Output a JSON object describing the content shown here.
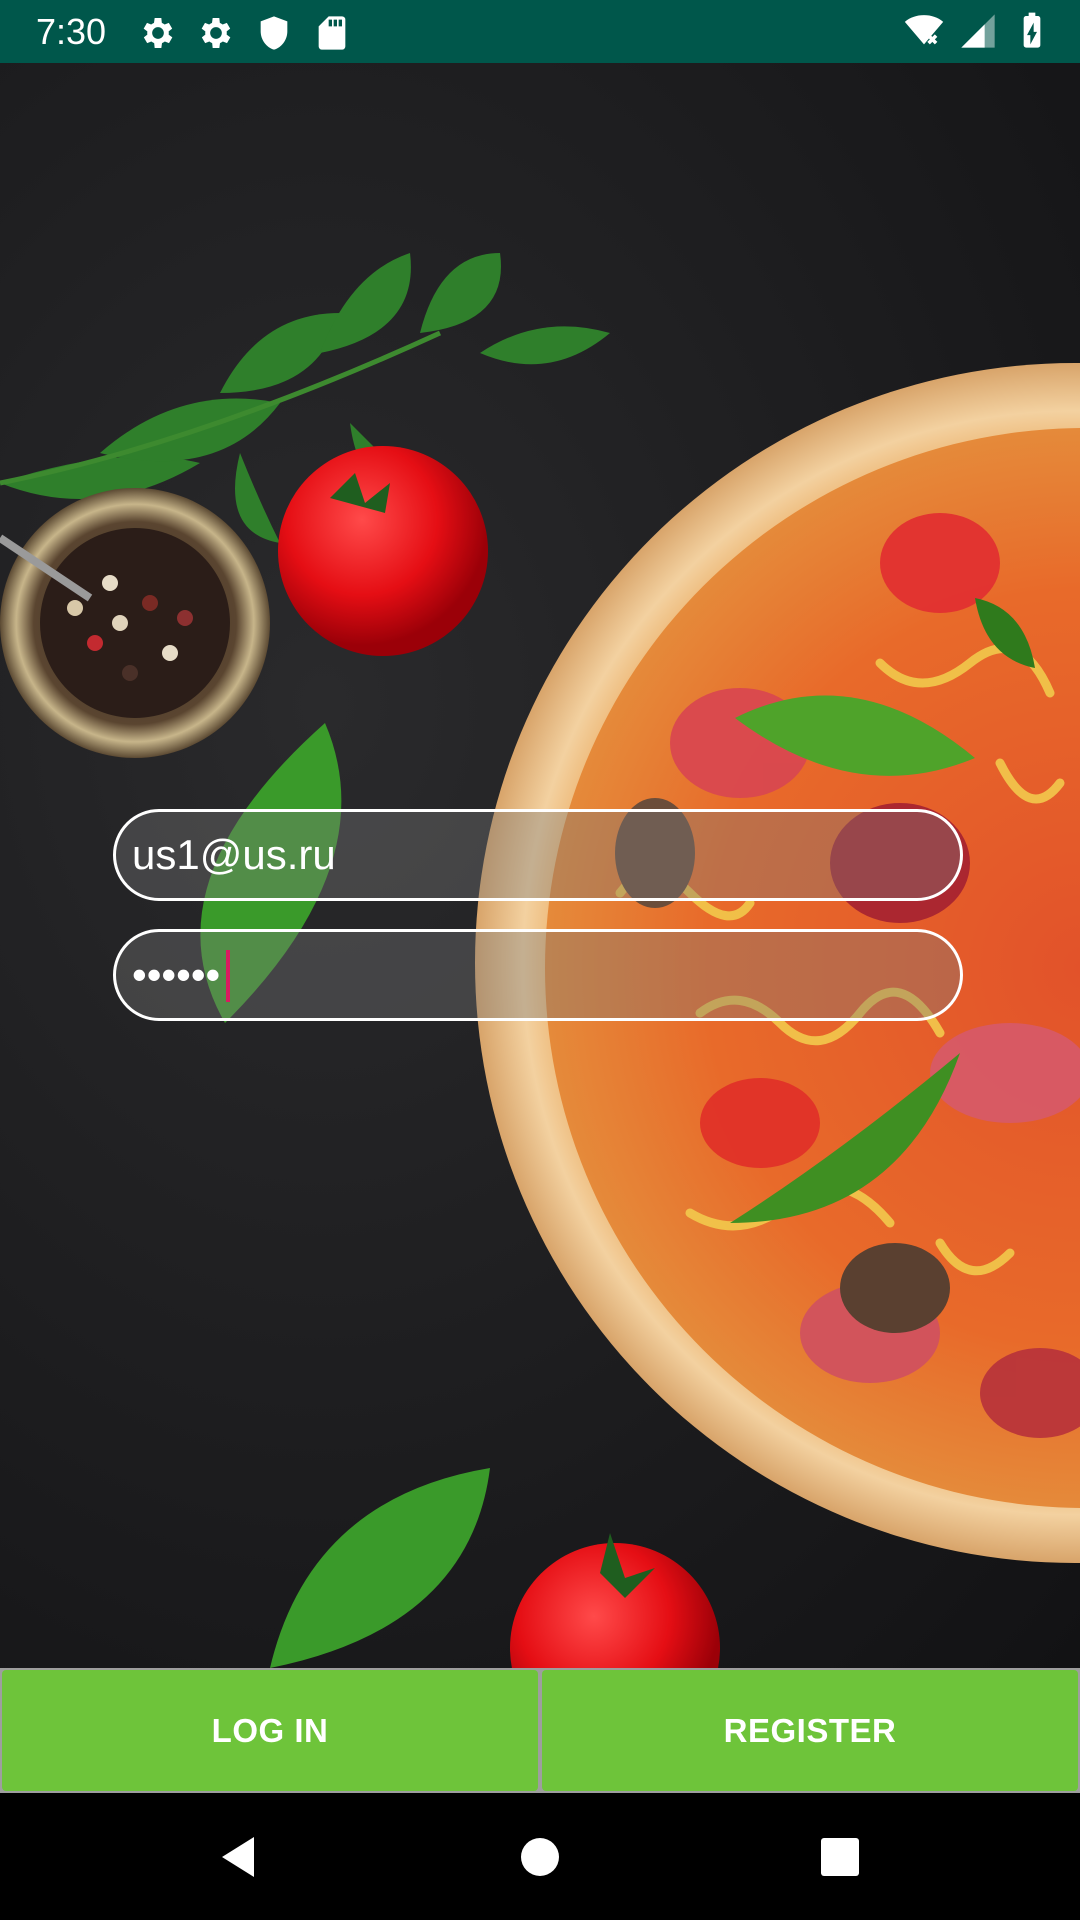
{
  "status_bar": {
    "time": "7:30",
    "left_icons": [
      "gear-icon",
      "gear-icon",
      "shield-icon",
      "sd-card-icon"
    ],
    "right_icons": [
      "wifi-off-icon",
      "cellular-signal-icon",
      "battery-charging-icon"
    ],
    "background_color": "#00574B"
  },
  "login_form": {
    "email_value": "us1@us.ru",
    "password_value": "••••••"
  },
  "buttons": {
    "login_label": "LOG IN",
    "register_label": "REGISTER",
    "color": "#6EC43A"
  },
  "nav_bar": {
    "icons": [
      "back-icon",
      "home-icon",
      "recents-icon"
    ]
  }
}
